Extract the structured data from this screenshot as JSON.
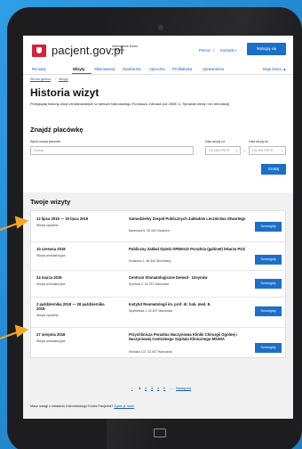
{
  "header": {
    "logo_text": "pacjent.gov.pl",
    "logo_sub": "Internetowe Konto Pacjenta",
    "help_link": "Pomoc ⓘ",
    "contrast_link": "Kontrast ◐",
    "logout_button": "Wyloguj się"
  },
  "nav": {
    "items": [
      "Recepty",
      "Wizyty",
      "Skierowania",
      "Zwolnienia",
      "Apteczka",
      "Profilaktyka",
      "Uprawnienia"
    ],
    "account": "Moje konto ▲"
  },
  "breadcrumb": [
    "Strona główna",
    "Wizyty"
  ],
  "page": {
    "title": "Historia wizyt",
    "description": "Przeglądaj historię wizyt zrealizowanych w ramach Narodowego Funduszu Zdrowia (od 2008 r.). Sprawdź kiedy i ich refundacji"
  },
  "search": {
    "title": "Znajdź placówkę",
    "name_label": "Wpisz nazwę placówki",
    "name_placeholder": "Szukaj",
    "date_from_label": "Data wizyty od",
    "date_to_label": "Data wizyty do",
    "date_placeholder": "DD.MM.RRRR",
    "button": "Szukaj"
  },
  "visits": {
    "title": "Twoje wizyty",
    "button_label": "Szczegóły",
    "items": [
      {
        "date": "12 lipca 2019 — 15 lipca 2019",
        "type": "Wizyta szpitalna",
        "name": "Samodzielny Zespół Publicznych Zakładów Lecznictwa Otwartego",
        "address": "Baranowa 6, 49-340 Olszanka"
      },
      {
        "date": "10 czerwca 2019",
        "type": "Wizyta ambulatoryjna",
        "name": "Publiczny Zakład Opieki OPIEKUS Poradnia (gabinet) lekarza POZ",
        "address": "Kwiatowa 1, 48-340 Głuchołazy"
      },
      {
        "date": "24 marca 2019",
        "type": "Wizyta ambulatoryjna",
        "name": "Centrum Stomatologiczne Demed - Ursynów",
        "address": "Symfonii 2, 02-787 Warszawa"
      },
      {
        "date": "2 października 2018 — 28 października 2018",
        "type": "Wizyta szpitalna",
        "name": "Instytut Reumatologii im. prof. dr. hab. med. E.",
        "address": "Spartańska 1, 02-637 Warszawa"
      },
      {
        "date": "27 sierpnia 2018",
        "type": "Wizyta ambulatoryjna",
        "name": "Przychlinicza Poradnia Naczyniowa Kliniki Chirurgii Ogólnej i Naczyniowej Centralnego Szpitala Klinicznego MSWiA",
        "address": "Wołoska 137, 02-507 Warszawa"
      }
    ]
  },
  "pagination": {
    "prev": "‹",
    "pages": [
      "1",
      "2",
      "3",
      "4",
      "5",
      "…"
    ],
    "next": "Następna"
  },
  "feedback": {
    "text": "Masz uwagi o działaniu Internetowego Konta Pacjenta?",
    "link": "Zgłoś je nam!"
  },
  "colors": {
    "accent": "#1b6fc8",
    "brand_red": "#d4213d",
    "background": "#2c9ae0",
    "arrow": "#f5a623"
  }
}
